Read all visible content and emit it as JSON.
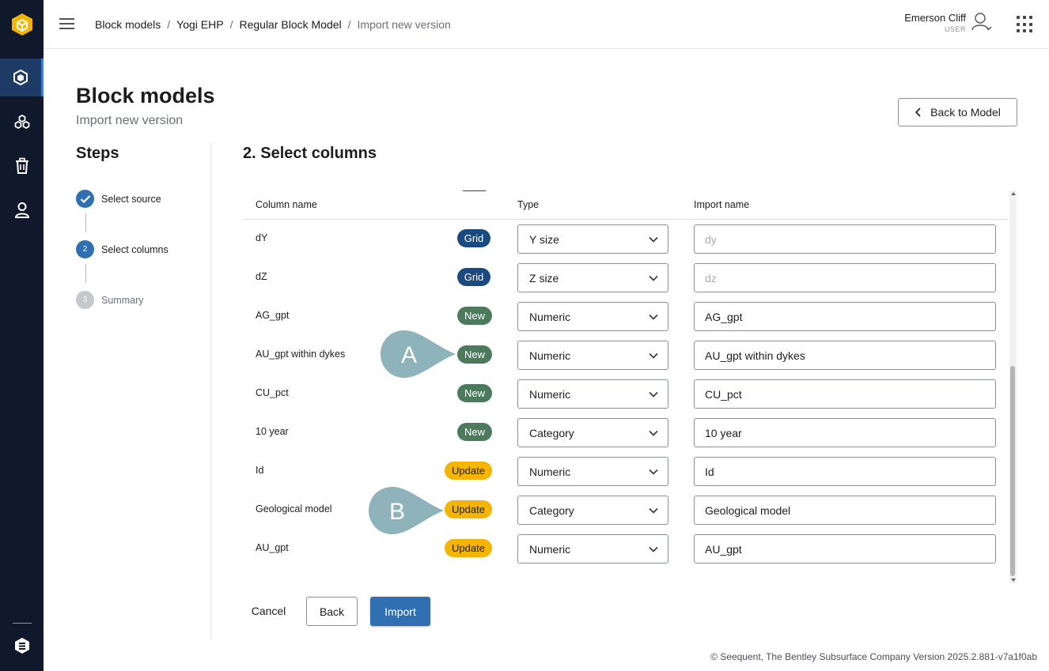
{
  "header": {
    "breadcrumb": [
      "Block models",
      "Yogi EHP",
      "Regular Block Model",
      "Import new version"
    ],
    "user_name": "Emerson Cliff",
    "user_role": "USER"
  },
  "page": {
    "title": "Block models",
    "subtitle": "Import new version",
    "back_to_model": "Back to Model"
  },
  "steps": {
    "title": "Steps",
    "items": [
      {
        "label": "Select source",
        "marker": "",
        "state": "done"
      },
      {
        "label": "Select columns",
        "marker": "2",
        "state": "current"
      },
      {
        "label": "Summary",
        "marker": "3",
        "state": "todo"
      }
    ]
  },
  "columns": {
    "title": "2. Select columns",
    "headers": {
      "name": "Column name",
      "type": "Type",
      "import": "Import name"
    },
    "rows": [
      {
        "name": "dY",
        "badge": "Grid",
        "badge_kind": "grid",
        "type": "Y size",
        "import_name": "",
        "placeholder": "dy"
      },
      {
        "name": "dZ",
        "badge": "Grid",
        "badge_kind": "grid",
        "type": "Z size",
        "import_name": "",
        "placeholder": "dz"
      },
      {
        "name": "AG_gpt",
        "badge": "New",
        "badge_kind": "new",
        "type": "Numeric",
        "import_name": "AG_gpt",
        "placeholder": ""
      },
      {
        "name": "AU_gpt within dykes",
        "badge": "New",
        "badge_kind": "new",
        "type": "Numeric",
        "import_name": "AU_gpt within dykes",
        "placeholder": ""
      },
      {
        "name": "CU_pct",
        "badge": "New",
        "badge_kind": "new",
        "type": "Numeric",
        "import_name": "CU_pct",
        "placeholder": ""
      },
      {
        "name": "10 year",
        "badge": "New",
        "badge_kind": "new",
        "type": "Category",
        "import_name": "10 year",
        "placeholder": ""
      },
      {
        "name": "Id",
        "badge": "Update",
        "badge_kind": "update",
        "type": "Numeric",
        "import_name": "Id",
        "placeholder": ""
      },
      {
        "name": "Geological model",
        "badge": "Update",
        "badge_kind": "update",
        "type": "Category",
        "import_name": "Geological model",
        "placeholder": ""
      },
      {
        "name": "AU_gpt",
        "badge": "Update",
        "badge_kind": "update",
        "type": "Numeric",
        "import_name": "AU_gpt",
        "placeholder": ""
      }
    ]
  },
  "callouts": {
    "a": "A",
    "b": "B"
  },
  "actions": {
    "cancel": "Cancel",
    "back": "Back",
    "import": "Import"
  },
  "footer": {
    "copyright": "© Seequent, The Bentley Subsurface Company   Version 2025.2.881-v7a1f0ab"
  },
  "colors": {
    "sidebar": "#10192b",
    "primary": "#2f6fb2",
    "grid_badge": "#1b4a80",
    "new_badge": "#4c7a5c",
    "update_badge": "#f4b400",
    "callout": "#8fb3ba",
    "logo": "#f4b400"
  }
}
